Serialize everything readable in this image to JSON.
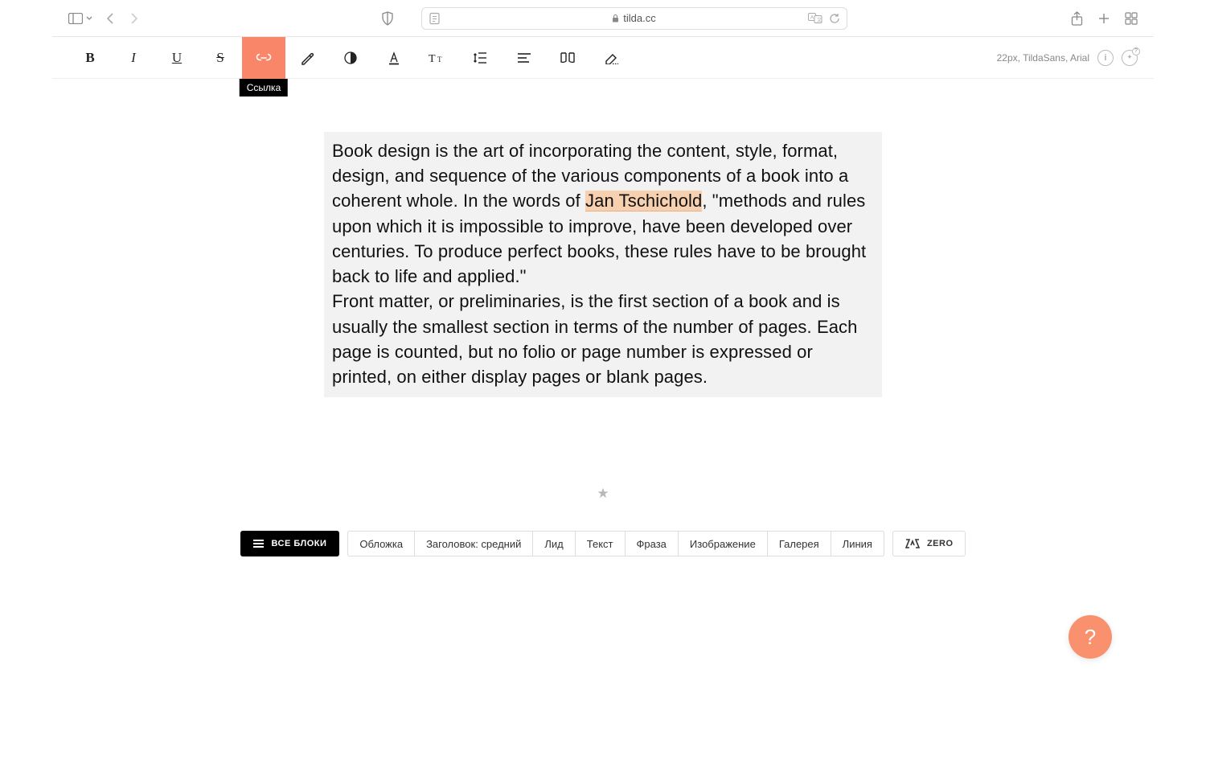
{
  "browser": {
    "url_host": "tilda.cc"
  },
  "toolbar": {
    "tooltip_link": "Ссылка",
    "font_info": "22px, TildaSans, Arial"
  },
  "content": {
    "para1_before": "Book design is the art of incorporating the content, style, format, design, and sequence of the various components of a book into a coherent whole. In the words of ",
    "linked_text": "Jan Tschichold",
    "para1_after": ", \"methods and rules upon which it is impossible to improve, have been developed over centuries. To produce perfect books, these rules have to be brought back to life and applied.\"",
    "para2": "Front matter, or preliminaries, is the first section of a book and is usually the smallest section in terms of the number of pages. Each page is counted, but no folio or page number is expressed or printed, on either display pages or blank pages."
  },
  "blockLibrary": {
    "all_label": "ВСЕ БЛОКИ",
    "categories": [
      "Обложка",
      "Заголовок: средний",
      "Лид",
      "Текст",
      "Фраза",
      "Изображение",
      "Галерея",
      "Линия"
    ],
    "zero_label": "ZERO"
  },
  "help": {
    "label": "?"
  }
}
